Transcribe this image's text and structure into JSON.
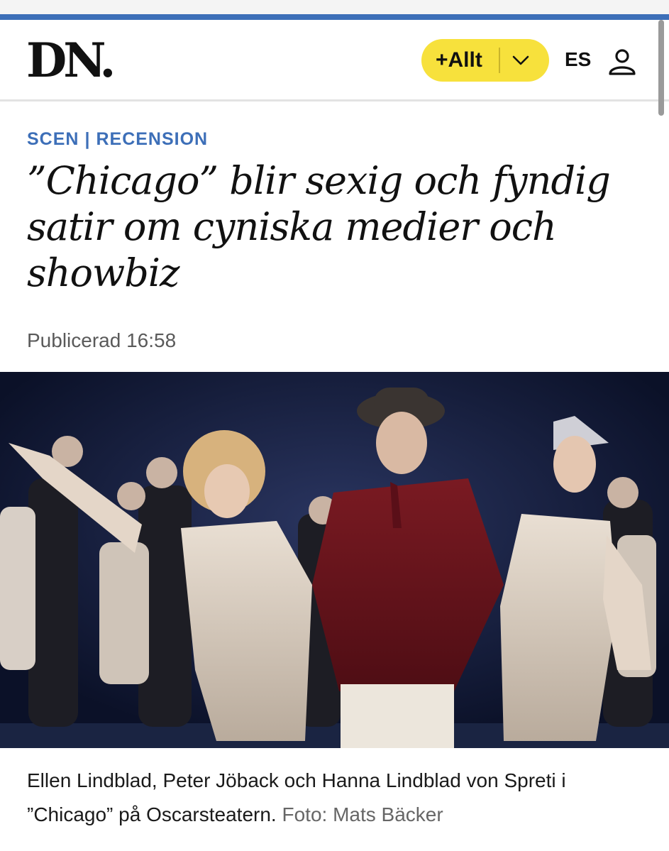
{
  "header": {
    "logo_text": "DN.",
    "menu_pill_label": "+Allt",
    "lang_label": "ES",
    "brand_accent_color": "#3d6fb8",
    "pill_color": "#f7e13c"
  },
  "article": {
    "section": "SCEN",
    "subsection": "RECENSION",
    "section_separator": "|",
    "headline": "”Chicago” blir sexig och fyndig satir om cyniska medier och showbiz",
    "published": "Publicerad 16:58"
  },
  "photo": {
    "caption": "Ellen Lindblad, Peter Jöback och Hanna Lindblad von Spreti i ”Chicago” på Oscarsteatern.",
    "credit": "Foto: Mats Bäcker"
  },
  "icons": [
    "chevron-down-icon",
    "user-icon"
  ]
}
